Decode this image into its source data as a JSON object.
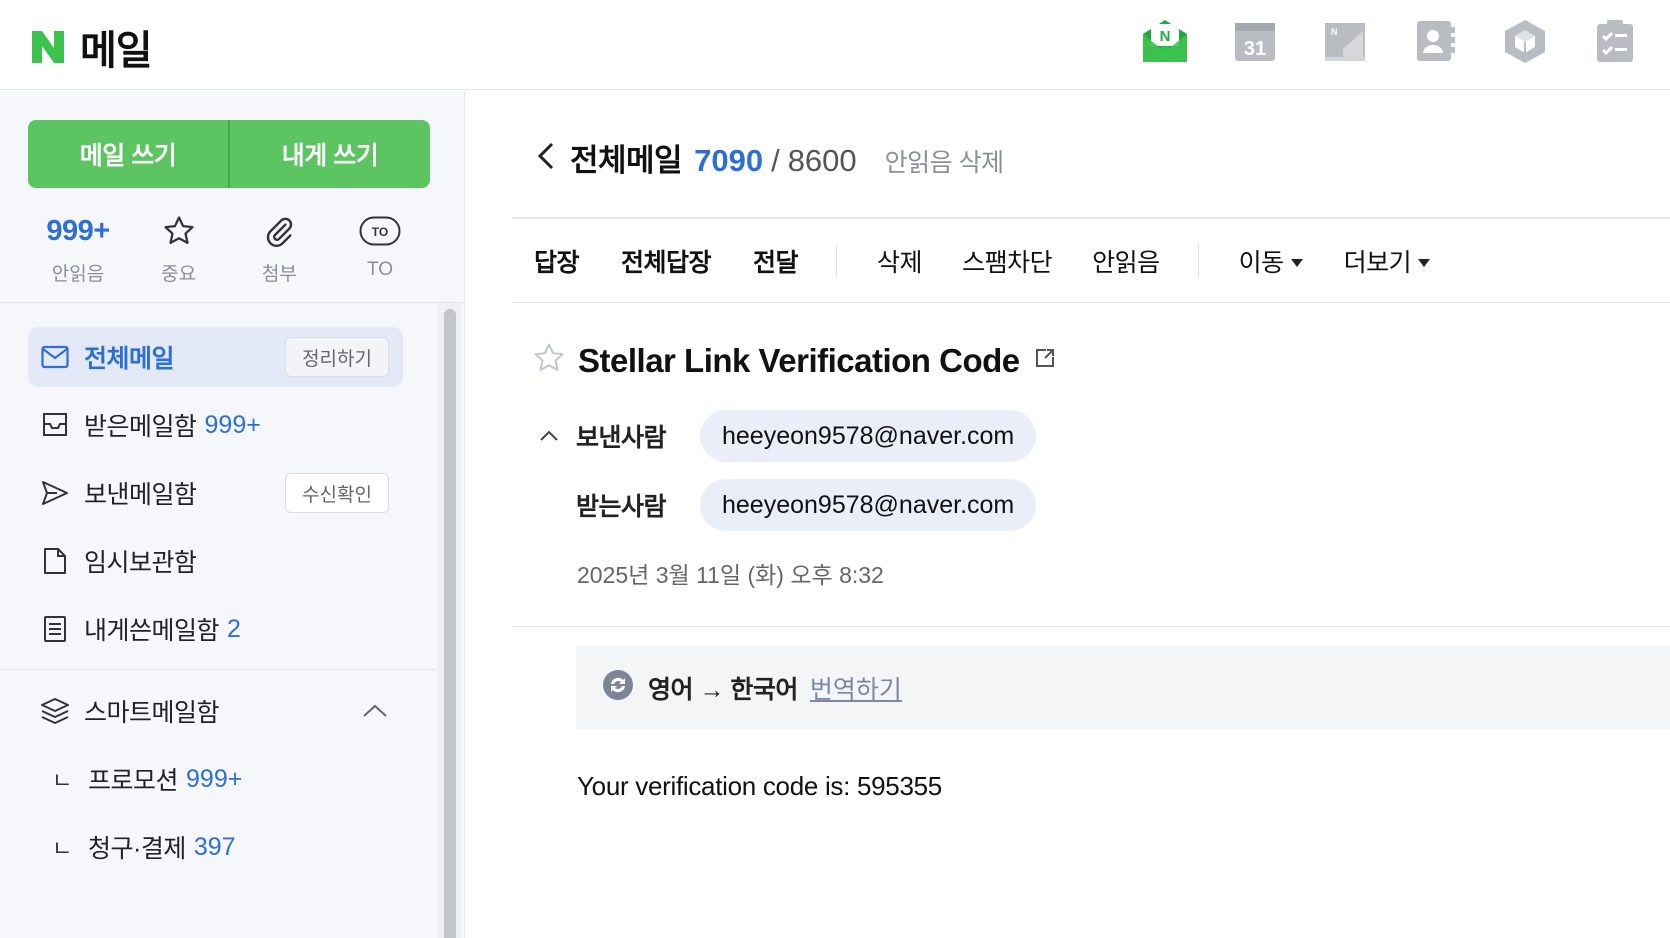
{
  "brand": {
    "title": "메일",
    "logo_letter": "N",
    "accent": "#5cc460",
    "link_blue": "#2d6fd6"
  },
  "topbar": {
    "apps": [
      "mail-icon",
      "calendar-icon",
      "note-icon",
      "contacts-icon",
      "box-icon",
      "todo-icon"
    ],
    "calendar_day": "31"
  },
  "sidebar": {
    "compose_label": "메일 쓰기",
    "self_compose_label": "내게 쓰기",
    "quick": [
      {
        "value": "999+",
        "label": "안읽음"
      },
      {
        "label": "중요"
      },
      {
        "label": "첨부"
      },
      {
        "label": "TO",
        "icon_text": "TO"
      }
    ],
    "folders": [
      {
        "label": "전체메일",
        "badge": "정리하기",
        "active": true
      },
      {
        "label": "받은메일함",
        "count": "999+"
      },
      {
        "label": "보낸메일함",
        "badge": "수신확인"
      },
      {
        "label": "임시보관함"
      },
      {
        "label": "내게쓴메일함",
        "count": "2"
      }
    ],
    "smart": {
      "label": "스마트메일함",
      "items": [
        {
          "mark": "ㄴ",
          "label": "프로모션",
          "count": "999+"
        },
        {
          "mark": "ㄴ",
          "label": "청구·결제",
          "count": "397"
        }
      ]
    }
  },
  "main": {
    "title": "전체메일",
    "unread": "7090",
    "slash": "/",
    "total": "8600",
    "delete_unread": "안읽음 삭제",
    "toolbar": {
      "reply": "답장",
      "reply_all": "전체답장",
      "forward": "전달",
      "delete": "삭제",
      "block_spam": "스팸차단",
      "mark_unread": "안읽음",
      "move": "이동",
      "more": "더보기"
    },
    "subject": "Stellar Link Verification Code",
    "sender_label": "보낸사람",
    "sender": "heeyeon9578@naver.com",
    "recipient_label": "받는사람",
    "recipient": "heeyeon9578@naver.com",
    "date": "2025년 3월 11일 (화) 오후 8:32",
    "translate": {
      "text": "영어 → 한국어",
      "link": "번역하기"
    },
    "body": "Your verification code is: 595355"
  }
}
